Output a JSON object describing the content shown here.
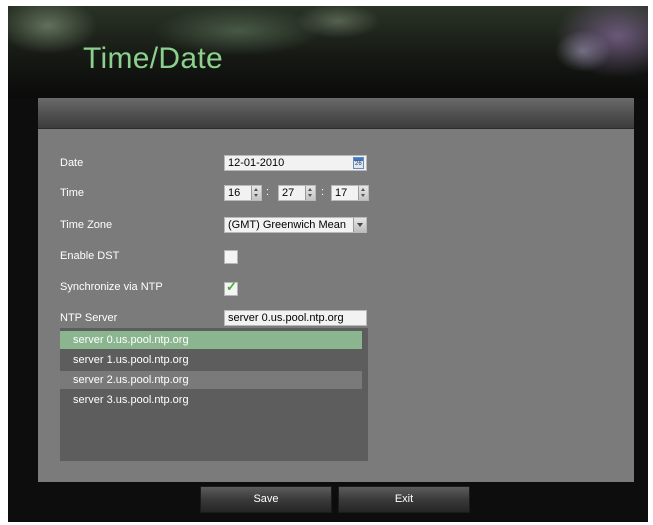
{
  "page": {
    "title": "Time/Date"
  },
  "form": {
    "date": {
      "label": "Date",
      "value": "12-01-2010",
      "calendar_day": "26"
    },
    "time": {
      "label": "Time",
      "hour": "16",
      "minute": "27",
      "second": "17",
      "separator": ":"
    },
    "time_zone": {
      "label": "Time Zone",
      "value": "(GMT) Greenwich Mean"
    },
    "enable_dst": {
      "label": "Enable DST",
      "checked": false
    },
    "sync_ntp": {
      "label": "Synchronize via NTP",
      "checked": true,
      "checkmark": "✓"
    },
    "ntp_server": {
      "label": "NTP Server",
      "value": "server 0.us.pool.ntp.org"
    }
  },
  "ntp_list": {
    "items": [
      "server 0.us.pool.ntp.org",
      "server 1.us.pool.ntp.org",
      "server 2.us.pool.ntp.org",
      "server 3.us.pool.ntp.org"
    ],
    "selected_index": 0,
    "highlighted_index": 2
  },
  "buttons": {
    "save": "Save",
    "exit": "Exit"
  },
  "colors": {
    "title": "#8bd08c",
    "panel": "#7b7b7b",
    "selected_row": "#8ab58f",
    "checkmark": "#4aa83a"
  },
  "icons": [
    "calendar-icon",
    "spinner-icon",
    "dropdown-arrow-icon",
    "checkmark-icon"
  ]
}
